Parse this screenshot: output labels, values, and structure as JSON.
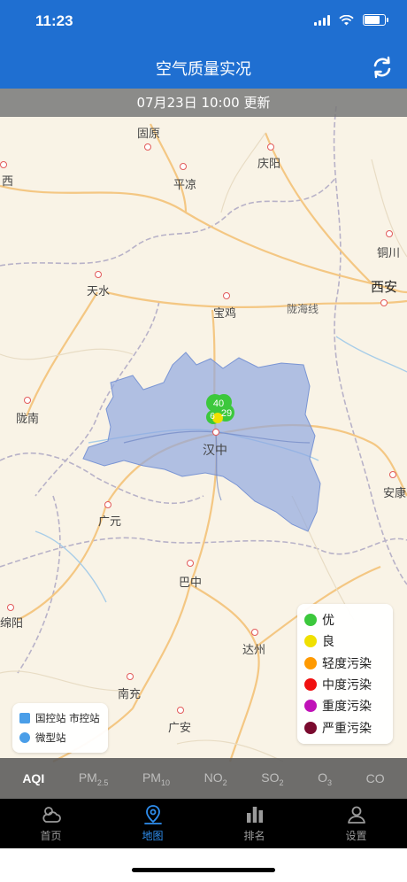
{
  "status": {
    "time": "11:23"
  },
  "nav": {
    "title": "空气质量实况"
  },
  "update": {
    "text": "07月23日 10:00 更新"
  },
  "map": {
    "cities": {
      "guyuan": "固原",
      "pingliang": "平凉",
      "qingyang": "庆阳",
      "xi": "西",
      "tianshui": "天水",
      "baoji": "宝鸡",
      "xian": "西安",
      "tongchuan": "铜川",
      "longhai": "陇海线",
      "longnan": "陇南",
      "hanzhong": "汉中",
      "ankang": "安康",
      "guangyuan": "广元",
      "bazhong": "巴中",
      "mianyang": "绵阳",
      "dazhou": "达州",
      "nanchong": "南充",
      "guangan": "广安"
    },
    "markers": [
      "40",
      "29",
      "6"
    ]
  },
  "legend": [
    {
      "label": "优",
      "color": "#3cc83c"
    },
    {
      "label": "良",
      "color": "#f0e000"
    },
    {
      "label": "轻度污染",
      "color": "#ff9a00"
    },
    {
      "label": "中度污染",
      "color": "#f01010"
    },
    {
      "label": "重度污染",
      "color": "#c012b8"
    },
    {
      "label": "严重污染",
      "color": "#7a0a2e"
    }
  ],
  "stations": {
    "national_city": "国控站 市控站",
    "micro": "微型站"
  },
  "pollutants": {
    "aqi": "AQI",
    "pm25": {
      "base": "PM",
      "sub": "2.5"
    },
    "pm10": {
      "base": "PM",
      "sub": "10"
    },
    "no2": {
      "base": "NO",
      "sub": "2"
    },
    "so2": {
      "base": "SO",
      "sub": "2"
    },
    "o3": {
      "base": "O",
      "sub": "3"
    },
    "co": "CO"
  },
  "tabs": {
    "home": "首页",
    "map": "地图",
    "rank": "排名",
    "settings": "设置"
  }
}
